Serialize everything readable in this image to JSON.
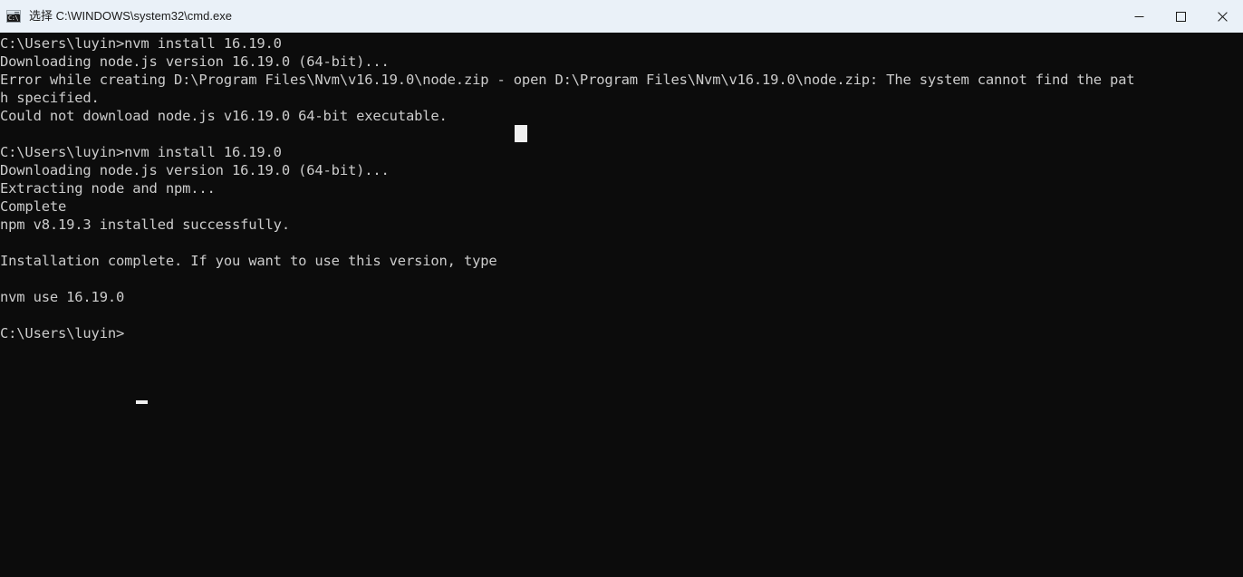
{
  "window": {
    "title": "选择 C:\\WINDOWS\\system32\\cmd.exe",
    "icon_name": "cmd-exe-icon",
    "icon_prompt_text": "C:\\",
    "titlebar_bg": "#eaf1f8",
    "console_bg": "#0c0c0c",
    "console_fg": "#cccccc",
    "cursor_color": "#f0f0f0",
    "controls": {
      "minimize_label": "—",
      "maximize_label": "☐",
      "close_label": "✕"
    }
  },
  "console": {
    "prompt": "C:\\Users\\luyin>",
    "lines": [
      "C:\\Users\\luyin>nvm install 16.19.0",
      "Downloading node.js version 16.19.0 (64-bit)...",
      "Error while creating D:\\Program Files\\Nvm\\v16.19.0\\node.zip - open D:\\Program Files\\Nvm\\v16.19.0\\node.zip: The system cannot find the pat",
      "h specified.",
      "Could not download node.js v16.19.0 64-bit executable.  ",
      "",
      "C:\\Users\\luyin>nvm install 16.19.0",
      "Downloading node.js version 16.19.0 (64-bit)...",
      "Extracting node and npm...",
      "Complete",
      "npm v8.19.3 installed successfully.",
      "",
      "Installation complete. If you want to use this version, type",
      "",
      "nvm use 16.19.0",
      "",
      "C:\\Users\\luyin>"
    ]
  }
}
